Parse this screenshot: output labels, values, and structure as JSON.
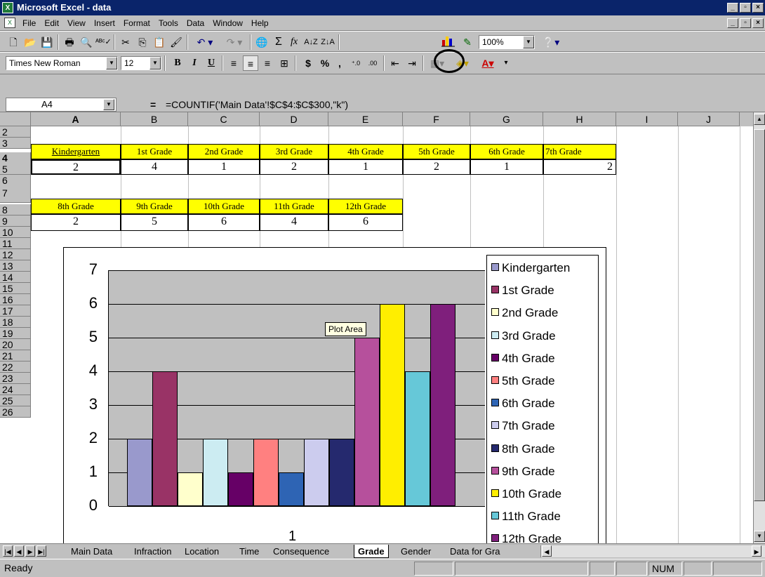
{
  "window": {
    "title": "Microsoft Excel - data",
    "icon": "excel-icon",
    "buttons": [
      "minimize",
      "maximize",
      "close"
    ]
  },
  "menubar": {
    "items": [
      "File",
      "Edit",
      "View",
      "Insert",
      "Format",
      "Tools",
      "Data",
      "Window",
      "Help"
    ]
  },
  "toolbar_standard": {
    "icons": [
      "new-icon",
      "open-icon",
      "save-icon",
      "print-icon",
      "print-preview-icon",
      "spelling-icon",
      "cut-icon",
      "copy-icon",
      "paste-icon",
      "format-painter-icon",
      "undo-icon",
      "redo-icon",
      "hyperlink-icon",
      "autosum-icon",
      "function-icon",
      "sort-ascending-icon",
      "sort-descending-icon",
      "chart-wizard-icon",
      "drawing-icon",
      "help-icon"
    ],
    "zoom": "100%"
  },
  "toolbar_formatting": {
    "font": "Times New Roman",
    "size": "12",
    "bold": "B",
    "italic": "I",
    "underline": "U",
    "currency": "$",
    "percent": "%",
    "comma": ","
  },
  "formula_bar": {
    "name_box": "A4",
    "equals": "=",
    "formula": "=COUNTIF('Main Data'!$C$4:$C$300,\"k\")"
  },
  "columns": [
    "A",
    "B",
    "C",
    "D",
    "E",
    "F",
    "G",
    "H",
    "I",
    "J"
  ],
  "rows": [
    "2",
    "3",
    "4",
    "5",
    "6",
    "7",
    "8",
    "9",
    "10",
    "11",
    "12",
    "13",
    "14",
    "15",
    "16",
    "17",
    "18",
    "19",
    "20",
    "21",
    "22",
    "23",
    "24",
    "25",
    "26"
  ],
  "table1": {
    "headers": [
      "Kindergarten",
      "1st Grade",
      "2nd Grade",
      "3rd Grade",
      "4th Grade",
      "5th Grade",
      "6th Grade",
      "7th Grade"
    ],
    "values": [
      "2",
      "4",
      "1",
      "2",
      "1",
      "2",
      "1",
      "2"
    ]
  },
  "table2": {
    "headers": [
      "8th Grade",
      "9th Grade",
      "10th Grade",
      "11th Grade",
      "12th Grade"
    ],
    "values": [
      "2",
      "5",
      "6",
      "4",
      "6"
    ]
  },
  "chart_data": {
    "type": "bar",
    "categories": [
      "1"
    ],
    "ylim": [
      0,
      7
    ],
    "yticks": [
      "0",
      "1",
      "2",
      "3",
      "4",
      "5",
      "6",
      "7"
    ],
    "grid": true,
    "legend_position": "right",
    "tooltip": "Plot Area",
    "series": [
      {
        "name": "Kindergarten",
        "values": [
          2
        ],
        "color": "#9999cc"
      },
      {
        "name": "1st Grade",
        "values": [
          4
        ],
        "color": "#993366"
      },
      {
        "name": "2nd Grade",
        "values": [
          1
        ],
        "color": "#ffffcc"
      },
      {
        "name": "3rd Grade",
        "values": [
          2
        ],
        "color": "#ccecf2"
      },
      {
        "name": "4th Grade",
        "values": [
          1
        ],
        "color": "#660066"
      },
      {
        "name": "5th Grade",
        "values": [
          2
        ],
        "color": "#ff8080"
      },
      {
        "name": "6th Grade",
        "values": [
          1
        ],
        "color": "#2e64b4"
      },
      {
        "name": "7th Grade",
        "values": [
          2
        ],
        "color": "#ccccee"
      },
      {
        "name": "8th Grade",
        "values": [
          2
        ],
        "color": "#25296e"
      },
      {
        "name": "9th Grade",
        "values": [
          5
        ],
        "color": "#b6509c"
      },
      {
        "name": "10th Grade",
        "values": [
          6
        ],
        "color": "#ffee00"
      },
      {
        "name": "11th Grade",
        "values": [
          4
        ],
        "color": "#66c8d8"
      },
      {
        "name": "12th Grade",
        "values": [
          6
        ],
        "color": "#7f1f7c"
      }
    ]
  },
  "sheet_tabs": [
    "Main Data",
    "Infraction",
    "Location",
    "Time",
    "Consequence",
    "Grade",
    "Gender",
    "Data for Gra"
  ],
  "active_tab": "Grade",
  "status": {
    "text": "Ready",
    "num": "NUM"
  }
}
